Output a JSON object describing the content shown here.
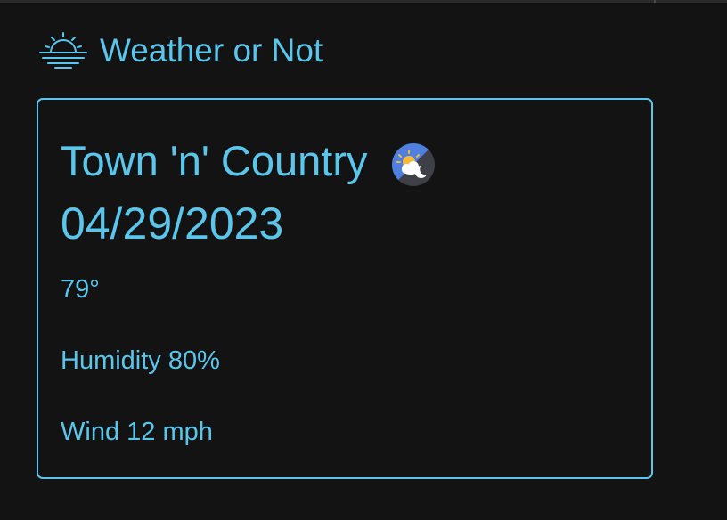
{
  "app": {
    "title": "Weather or Not",
    "logo_icon": "sunrise-icon",
    "accent_color": "#5bc6eb",
    "background_color": "#131313"
  },
  "forecast": {
    "city": "Town 'n' Country",
    "condition_icon": "partly-cloudy-night-icon",
    "date": "04/29/2023",
    "temperature": "79°",
    "humidity": "Humidity 80%",
    "wind": "Wind 12 mph"
  }
}
